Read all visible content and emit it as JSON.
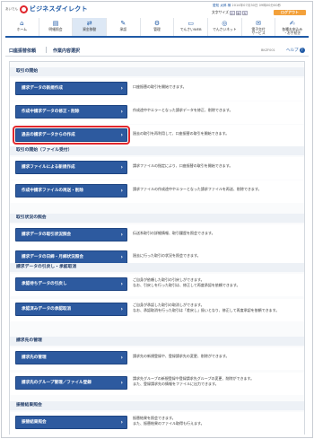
{
  "header": {
    "logo_prefix": "あいでん",
    "logo_text": "ビジネスダイレクト",
    "user_line1": "愛知 太郎 様",
    "user_line2": "2014年07月30日 09時00分00秒",
    "font_size_label": "文字サイズ",
    "font_small": "小",
    "font_medium": "中",
    "font_large": "大",
    "logout_label": "ログアウト"
  },
  "nav": [
    {
      "label": "ホーム",
      "icon": "home-icon",
      "glyph": "⌂"
    },
    {
      "label": "明細照会",
      "icon": "document-icon",
      "glyph": "▤"
    },
    {
      "label": "資金移動",
      "icon": "transfer-icon",
      "glyph": "⇄"
    },
    {
      "label": "承認",
      "icon": "approve-icon",
      "glyph": "✎"
    },
    {
      "label": "管理",
      "icon": "gear-icon",
      "glyph": "⚙"
    },
    {
      "label": "でんさいWEB",
      "icon": "monitor-icon",
      "glyph": "▭"
    },
    {
      "label": "でんさいネット",
      "icon": "network-icon",
      "glyph": "◎"
    },
    {
      "label": "電子交付\nサービス",
      "icon": "mail-icon",
      "glyph": "✉"
    },
    {
      "label": "各種お申込み\n・お手続き",
      "icon": "form-icon",
      "glyph": "✍"
    }
  ],
  "title": {
    "left": "口座振替依頼",
    "right": "作業内容選択",
    "screen_id": "BKZF001",
    "help": "ヘルプ",
    "help_mark": "?"
  },
  "sections": [
    {
      "heading": "取引の開始",
      "rows": [
        {
          "button": "請求データの新規作成",
          "desc": [
            "口座振替の取引を開始できます。"
          ]
        },
        {
          "button": "作成中請求データの修正・削除",
          "desc": [
            "作成途中やエラーとなった請求データを修正、削除できます。"
          ]
        },
        {
          "button": "過去の請求データからの作成",
          "desc": [
            "過去の取引を再利用して、口座振替の取引を開始できます。"
          ],
          "highlight": true
        }
      ]
    },
    {
      "heading": "取引の開始（ファイル受付）",
      "rows": [
        {
          "button": "請求ファイルによる新規作成",
          "desc": [
            "請求ファイルの指定により、口座振替の取引を開始できます。"
          ]
        },
        {
          "button": "作成中請求ファイルの再送・削除",
          "desc": [
            "請求ファイルの作成途中やエラーとなった請求ファイルを再送、削除できます。"
          ]
        }
      ]
    },
    {
      "heading": "取引状況の照会",
      "rows": [
        {
          "button": "請求データの取引状況照会",
          "desc": [
            "伝送系取引の詳細情報、取引履歴を照会できます。"
          ]
        },
        {
          "button": "請求データの日締・月締状況照会",
          "desc": [
            "過去に行った取引の状況を照会できます。"
          ]
        }
      ]
    },
    {
      "heading": "請求データの引戻し・承認取消",
      "rows": [
        {
          "button": "承認待ちデータの引戻し",
          "desc": [
            "ご自身が依頼した取引の引戻しができます。",
            "なお、引戻しを行った取引は、修正して再度承認を依頼できます。"
          ]
        },
        {
          "button": "承認済みデータの承認取消",
          "desc": [
            "ご自身が承認した取引の取消しができます。",
            "なお、承認取消を行った取引は「差戻し」扱いとなり、修正して再度承認を依頼できます。"
          ]
        }
      ]
    },
    {
      "heading": "請求先の管理",
      "rows": [
        {
          "button": "請求先の管理",
          "desc": [
            "請求先の新規登録や、登録請求先の変更、削除ができます。"
          ]
        },
        {
          "button": "請求先のグループ管理／ファイル登録",
          "desc": [
            "請求先グループの新規登録や登録請求先グループの変更、削除ができます。",
            "また、登録請求先の情報をファイルに出力できます。"
          ]
        }
      ]
    },
    {
      "heading": "振替結果照会",
      "rows": [
        {
          "button": "振替結果照会",
          "desc": [
            "振替結果を照会できます。",
            "また、振替結果のファイル取得も行えます。"
          ]
        }
      ]
    }
  ]
}
